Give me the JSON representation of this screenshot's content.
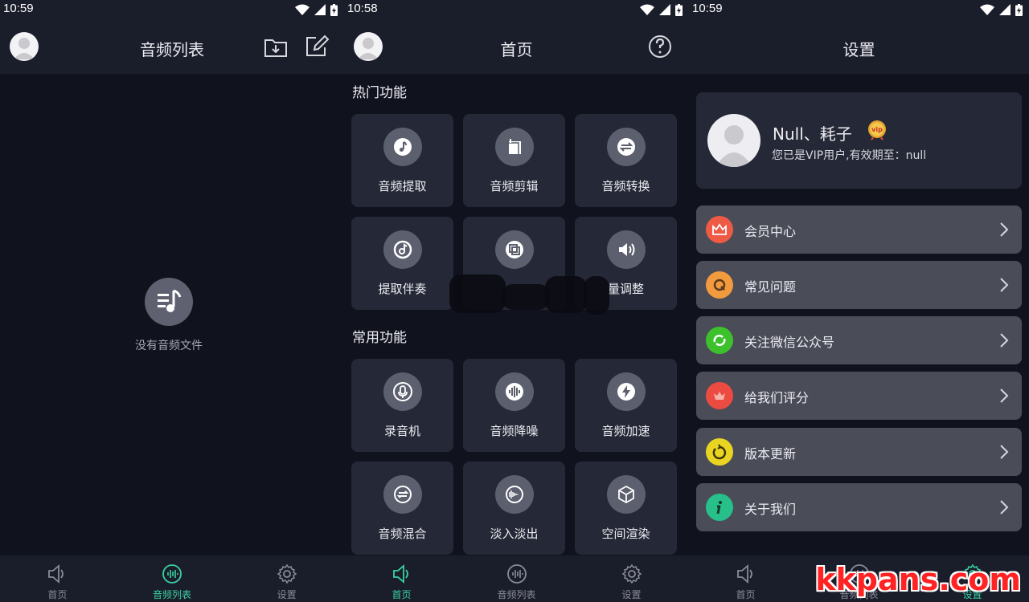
{
  "colors": {
    "accent": "#3ad3a3",
    "bg": "#10121e",
    "bar": "#1a1d2a",
    "card": "#252836",
    "row": "#4a4c58"
  },
  "status": {
    "time1": "10:59",
    "time2": "10:58",
    "time3": "10:59"
  },
  "screen1": {
    "title": "音频列表",
    "empty_text": "没有音频文件",
    "icons": [
      "avatar",
      "folder-download-icon",
      "edit-icon"
    ]
  },
  "screen2": {
    "title": "首页",
    "hot_title": "热门功能",
    "common_title": "常用功能",
    "hot": [
      {
        "label": "音频提取",
        "icon": "music-note-icon"
      },
      {
        "label": "音频剪辑",
        "icon": "crop-icon"
      },
      {
        "label": "音频转换",
        "icon": "convert-icon"
      },
      {
        "label": "提取伴奏",
        "icon": "disc-icon"
      },
      {
        "label": "",
        "icon": "copy-icon"
      },
      {
        "label": "量调整",
        "icon": "volume-icon"
      }
    ],
    "common": [
      {
        "label": "录音机",
        "icon": "microphone-icon"
      },
      {
        "label": "音频降噪",
        "icon": "waveform-icon"
      },
      {
        "label": "音频加速",
        "icon": "lightning-icon"
      },
      {
        "label": "音频混合",
        "icon": "mix-icon"
      },
      {
        "label": "淡入淡出",
        "icon": "fade-icon"
      },
      {
        "label": "空间渲染",
        "icon": "cube-icon"
      }
    ]
  },
  "screen3": {
    "title": "设置",
    "user_name": "Null、耗子",
    "vip_text": "您已是VIP用户,有效期至：null",
    "vip_badge": "vip",
    "menu": [
      {
        "label": "会员中心",
        "icon": "crown-icon",
        "color": "#ef5a45"
      },
      {
        "label": "常见问题",
        "icon": "question-icon",
        "color": "#f19a3e"
      },
      {
        "label": "关注微信公众号",
        "icon": "wechat-icon",
        "color": "#3cc12d"
      },
      {
        "label": "给我们评分",
        "icon": "rate-icon",
        "color": "#ec4b42"
      },
      {
        "label": "版本更新",
        "icon": "update-icon",
        "color": "#e9d521"
      },
      {
        "label": "关于我们",
        "icon": "info-icon",
        "color": "#27c08a"
      }
    ]
  },
  "nav": {
    "home": "首页",
    "list": "音频列表",
    "settings": "设置"
  },
  "watermark": "kkpans.com"
}
